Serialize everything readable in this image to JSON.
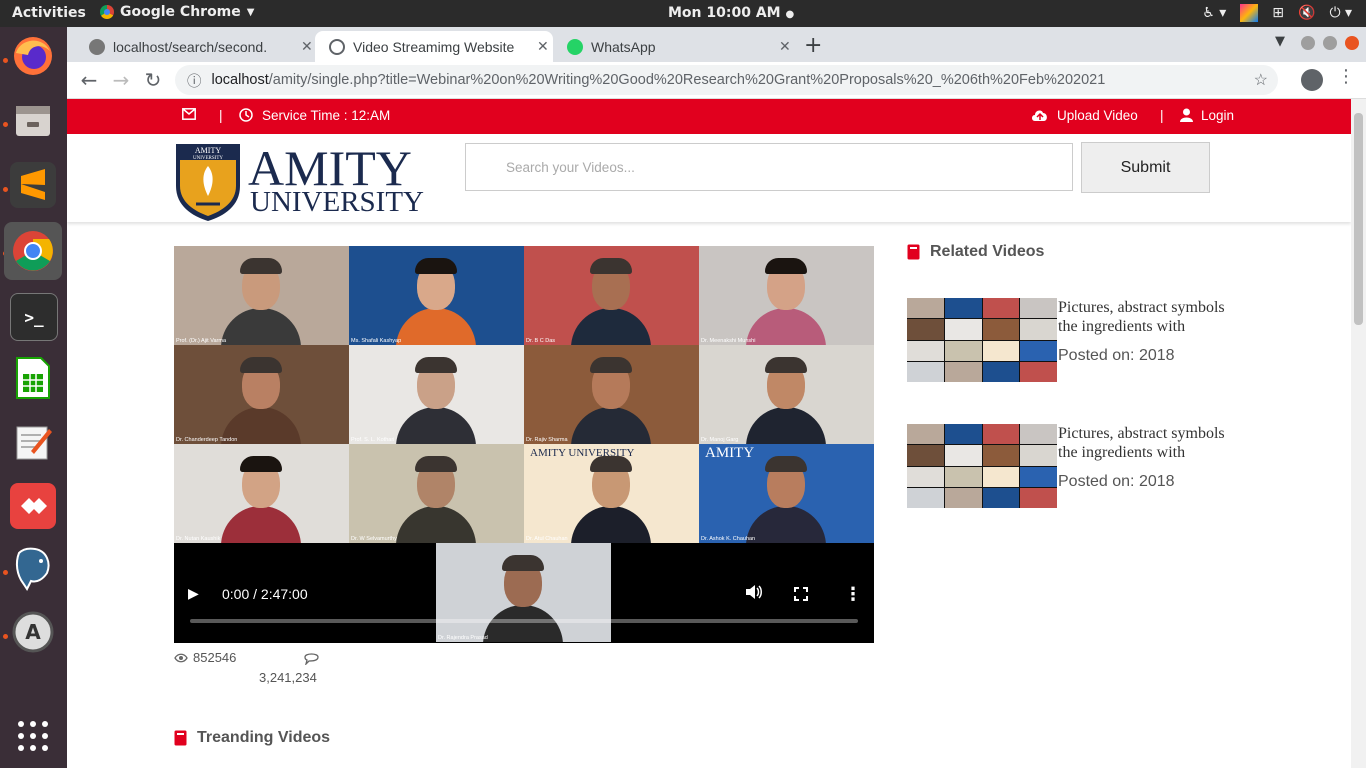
{
  "system": {
    "activities": "Activities",
    "app_name": "Google Chrome",
    "clock": "Mon 10:00 AM"
  },
  "browser": {
    "tabs": [
      {
        "label": "localhost/search/second.",
        "active": false
      },
      {
        "label": "Video Streamimg Website",
        "active": true
      },
      {
        "label": "WhatsApp",
        "active": false
      }
    ],
    "url_host": "localhost",
    "url_path": "/amity/single.php?title=Webinar%20on%20Writing%20Good%20Research%20Grant%20Proposals%20_%206th%20Feb%202021"
  },
  "topbar": {
    "service_time": "Service Time : 12:AM",
    "upload_label": "Upload Video",
    "login_label": "Login",
    "separator": "|"
  },
  "header": {
    "logo_badge": "AMITY UNIVERSITY",
    "logo_line1": "AMITY",
    "logo_line2": "UNIVERSITY",
    "search_placeholder": "Search your Videos...",
    "submit_label": "Submit"
  },
  "video": {
    "time": "0:00 / 2:47:00",
    "participants": [
      "Prof. (Dr.) Ajit Varma",
      "Ms. Shafali Kashyap",
      "Dr. B C Das",
      "Dr. Meenakshi Munshi",
      "Dr. Chanderdeep Tandon",
      "Prof. S. L. Kothari",
      "Dr. Rajiv Sharma",
      "Dr. Manoj Garg",
      "Dr. Nutan Kaushik",
      "Dr. W Selvamurthy",
      "Dr. Atul Chauhan",
      "Dr. Ashok K. Chauhan",
      "Dr. Rajendra Prasad"
    ],
    "tile_colors": [
      "#b9a89a",
      "#1d4f8f",
      "#c0504d",
      "#c9c5c2",
      "#6e4f3a",
      "#e9e7e4",
      "#8c5b3b",
      "#d9d6d0",
      "#e0ddd9",
      "#c9c2ae",
      "#f5e7cf",
      "#2a62b0",
      "#cfd2d6"
    ],
    "overlay_logo": "AMITY UNIVERSITY",
    "overlay_logo2": "AMITY"
  },
  "stats": {
    "views": "852546",
    "comments": "3,241,234"
  },
  "related": {
    "title": "Related Videos",
    "items": [
      {
        "title": "Pictures, abstract symbols the ingredients with",
        "date": "Posted on: 2018"
      },
      {
        "title": "Pictures, abstract symbols the ingredients with",
        "date": "Posted on: 2018"
      }
    ]
  },
  "trending": {
    "title": "Treanding Videos"
  },
  "colors": {
    "brand_red": "#e1001e",
    "amity_navy": "#1b2a4e",
    "amity_gold": "#e8a21d"
  }
}
